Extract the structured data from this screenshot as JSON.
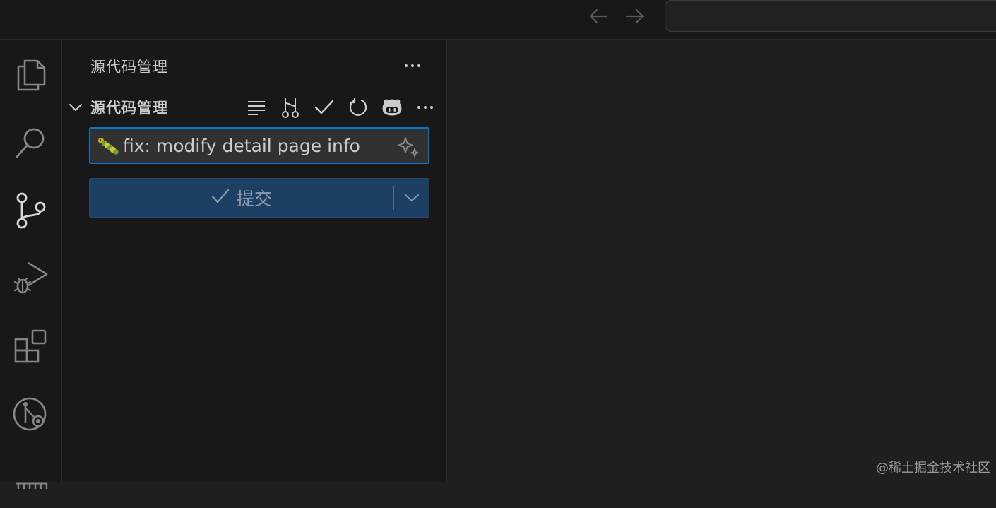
{
  "titlebar": {
    "back_icon": "arrow-left-icon",
    "forward_icon": "arrow-right-icon"
  },
  "activity_bar": {
    "items": [
      {
        "name": "explorer",
        "icon": "files-icon"
      },
      {
        "name": "search",
        "icon": "search-icon"
      },
      {
        "name": "source-control",
        "icon": "source-control-icon"
      },
      {
        "name": "run-and-debug",
        "icon": "debug-icon"
      },
      {
        "name": "extensions",
        "icon": "extensions-icon"
      },
      {
        "name": "git-graph",
        "icon": "git-lens-icon"
      },
      {
        "name": "testing",
        "icon": "panel-icon"
      }
    ]
  },
  "sidebar": {
    "title": "源代码管理",
    "section": {
      "title": "源代码管理",
      "toolbar_icons": [
        "list-icon",
        "git-compare-icon",
        "check-icon",
        "refresh-icon",
        "copilot-icon",
        "more-icon"
      ]
    },
    "commit_message": {
      "value": "fix: modify detail page info",
      "emoji_icon": "caterpillar-icon",
      "sparkle_icon": "sparkle-icon"
    },
    "commit_button": {
      "label": "提交"
    }
  },
  "watermark": "@稀土掘金技术社区",
  "colors": {
    "accent": "#0078d4",
    "commit_button_bg": "#1c3f63",
    "sidebar_bg": "#181818",
    "editor_bg": "#1f1f1f"
  }
}
